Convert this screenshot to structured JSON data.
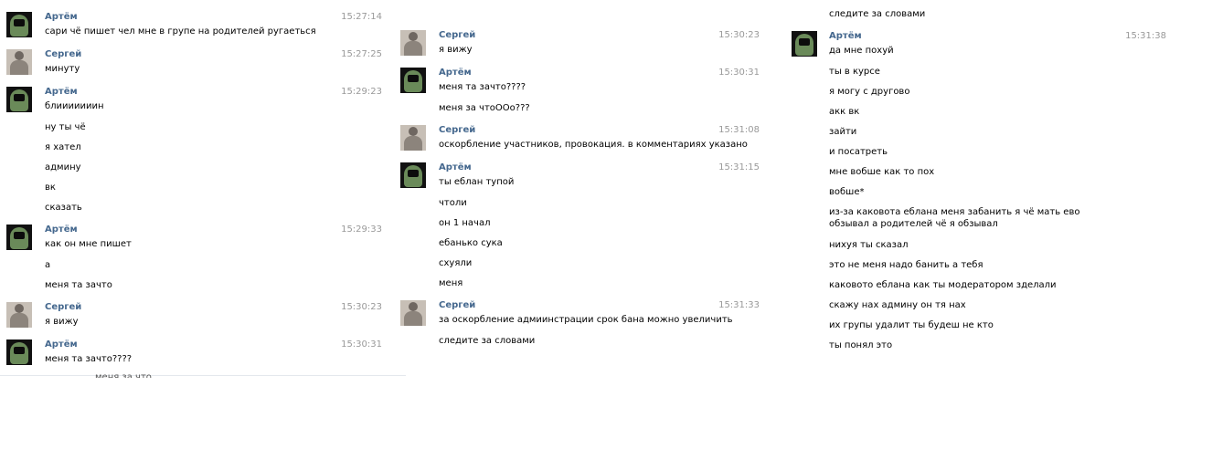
{
  "authors": {
    "artem": "Артём",
    "sergey": "Сергей"
  },
  "columns": [
    {
      "messages": [
        {
          "author": "artem",
          "time": "15:27:14",
          "lines": [
            "сари чё пишет чел мне в групе на родителей ругаеться"
          ]
        },
        {
          "author": "sergey",
          "time": "15:27:25",
          "lines": [
            "минуту"
          ]
        },
        {
          "author": "artem",
          "time": "15:29:23",
          "lines": [
            "блииииииин",
            "ну ты чё",
            "я хател",
            "админу",
            "вк",
            "сказать"
          ]
        },
        {
          "author": "artem",
          "time": "15:29:33",
          "lines": [
            "как он мне пишет",
            "а",
            "меня та зачто"
          ]
        },
        {
          "author": "sergey",
          "time": "15:30:23",
          "lines": [
            "я вижу"
          ]
        },
        {
          "author": "artem",
          "time": "15:30:31",
          "lines": [
            "меня та зачто????"
          ]
        }
      ],
      "cut_text": "меня за что"
    },
    {
      "messages": [
        {
          "author": "sergey",
          "time": "15:30:23",
          "lines": [
            "я вижу"
          ]
        },
        {
          "author": "artem",
          "time": "15:30:31",
          "lines": [
            "меня та зачто????",
            "меня за чтоООо???"
          ]
        },
        {
          "author": "sergey",
          "time": "15:31:08",
          "lines": [
            "оскорбление участников, провокация. в комментариях указано"
          ]
        },
        {
          "author": "artem",
          "time": "15:31:15",
          "lines": [
            "ты еблан тупой",
            "чтоли",
            "он 1 начал",
            "ебанько сука",
            "схуяли",
            "меня"
          ]
        },
        {
          "author": "sergey",
          "time": "15:31:33",
          "lines": [
            "за оскорбление адмиинстрации срок бана можно увеличить",
            "следите за словами"
          ]
        }
      ]
    },
    {
      "top_line": "следите за словами",
      "messages": [
        {
          "author": "artem",
          "time": "15:31:38",
          "lines": [
            "да мне похуй",
            "ты в курсе",
            "я могу с другово",
            "акк вк",
            "зайти",
            "и посатреть",
            "мне вобше как то пох",
            "вобше*",
            "из-за каковота еблана меня забанить я чё мать ево обзывал а родителей чё я обзывал",
            "нихуя ты сказал",
            "это не меня надо банить а тебя",
            "каковото еблана как ты модератором зделали",
            "скажу нах админу он тя нах",
            "их групы удалит ты будеш не кто",
            "ты понял это"
          ]
        }
      ]
    }
  ]
}
